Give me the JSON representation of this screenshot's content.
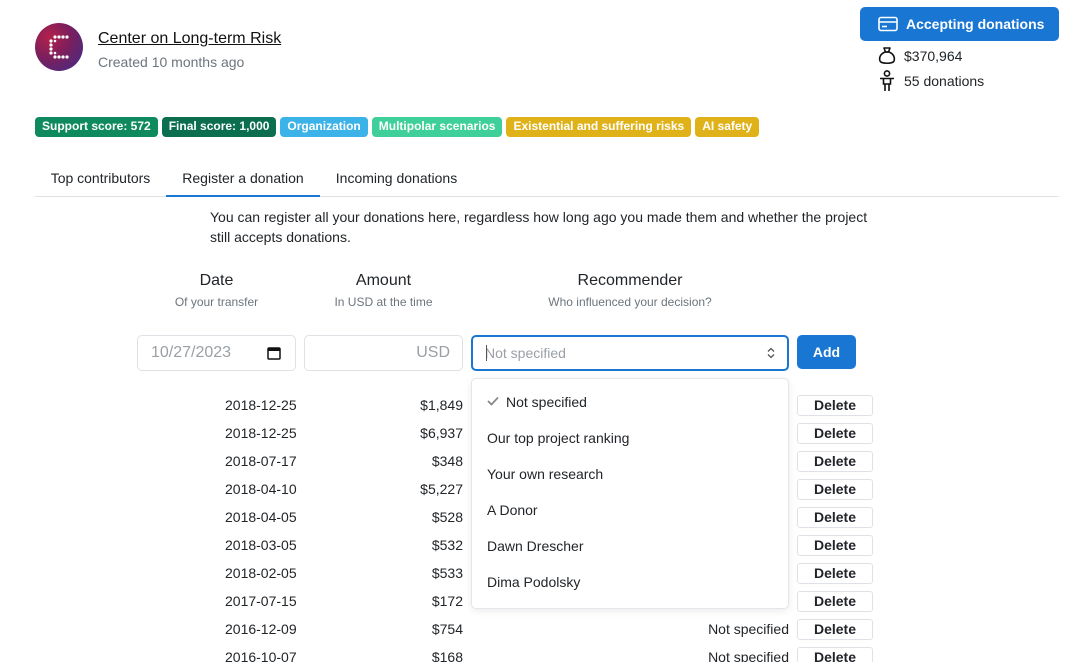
{
  "header": {
    "org_name": "Center on Long-term Risk",
    "created": "Created 10 months ago",
    "accept_label": "Accepting donations",
    "total": "$370,964",
    "donations_count": "55 donations"
  },
  "badges": [
    {
      "label": "Support score: 572",
      "color": "#0f8a5f"
    },
    {
      "label": "Final score: 1,000",
      "color": "#0b6e4f"
    },
    {
      "label": "Organization",
      "color": "#3bb3e8"
    },
    {
      "label": "Multipolar scenarios",
      "color": "#3ecf9a"
    },
    {
      "label": "Existential and suffering risks",
      "color": "#e0b21a"
    },
    {
      "label": "AI safety",
      "color": "#e0b21a"
    }
  ],
  "tabs": [
    {
      "label": "Top contributors"
    },
    {
      "label": "Register a donation"
    },
    {
      "label": "Incoming donations"
    }
  ],
  "intro": "You can register all your donations here, regardless how long ago you made them and whether the project still accepts donations.",
  "columns": {
    "date": {
      "title": "Date",
      "sub": "Of your transfer"
    },
    "amount": {
      "title": "Amount",
      "sub": "In USD at the time"
    },
    "recommender": {
      "title": "Recommender",
      "sub": "Who influenced your decision?"
    }
  },
  "form": {
    "date_value": "10/27/2023",
    "usd_placeholder": "USD",
    "recommender_placeholder": "Not specified",
    "add_label": "Add"
  },
  "dropdown_options": [
    "Not specified",
    "Our top project ranking",
    "Your own research",
    "A Donor",
    "Dawn Drescher",
    "Dima Podolsky"
  ],
  "donations": [
    {
      "date": "2018-12-25",
      "amount": "$1,849",
      "recommender": ""
    },
    {
      "date": "2018-12-25",
      "amount": "$6,937",
      "recommender": ""
    },
    {
      "date": "2018-07-17",
      "amount": "$348",
      "recommender": ""
    },
    {
      "date": "2018-04-10",
      "amount": "$5,227",
      "recommender": ""
    },
    {
      "date": "2018-04-05",
      "amount": "$528",
      "recommender": ""
    },
    {
      "date": "2018-03-05",
      "amount": "$532",
      "recommender": ""
    },
    {
      "date": "2018-02-05",
      "amount": "$533",
      "recommender": ""
    },
    {
      "date": "2017-07-15",
      "amount": "$172",
      "recommender": ""
    },
    {
      "date": "2016-12-09",
      "amount": "$754",
      "recommender": "Not specified"
    },
    {
      "date": "2016-10-07",
      "amount": "$168",
      "recommender": "Not specified"
    }
  ],
  "delete_label": "Delete",
  "colors": {
    "primary": "#1976d2",
    "muted": "#6c757d",
    "border": "#dee2e6"
  },
  "icons": {
    "logo": "org-logo",
    "accept": "credit-card-icon",
    "total": "money-bag-icon",
    "donors": "person-icon",
    "date": "calendar-icon",
    "select": "updown-chevron-icon",
    "check": "check-icon"
  }
}
